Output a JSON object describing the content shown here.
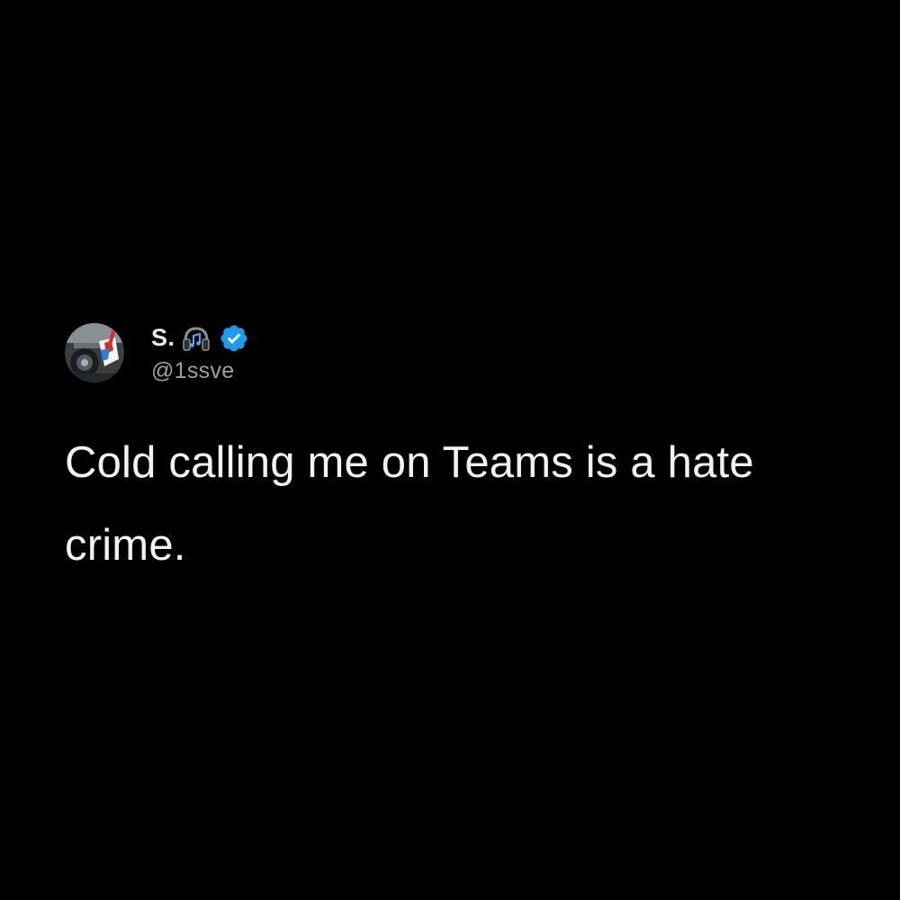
{
  "tweet": {
    "author": {
      "display_name": "S.",
      "handle": "@1ssve",
      "name_emoji_icon": "headphones-music-icon",
      "verified_icon": "verified-badge-icon",
      "avatar_icon": "profile-avatar"
    },
    "text": "Cold calling me on Teams is a hate crime."
  },
  "colors": {
    "background": "#000000",
    "text": "#f2f2f2",
    "handle": "#9aa0a6",
    "verified": "#1d9bf0"
  }
}
